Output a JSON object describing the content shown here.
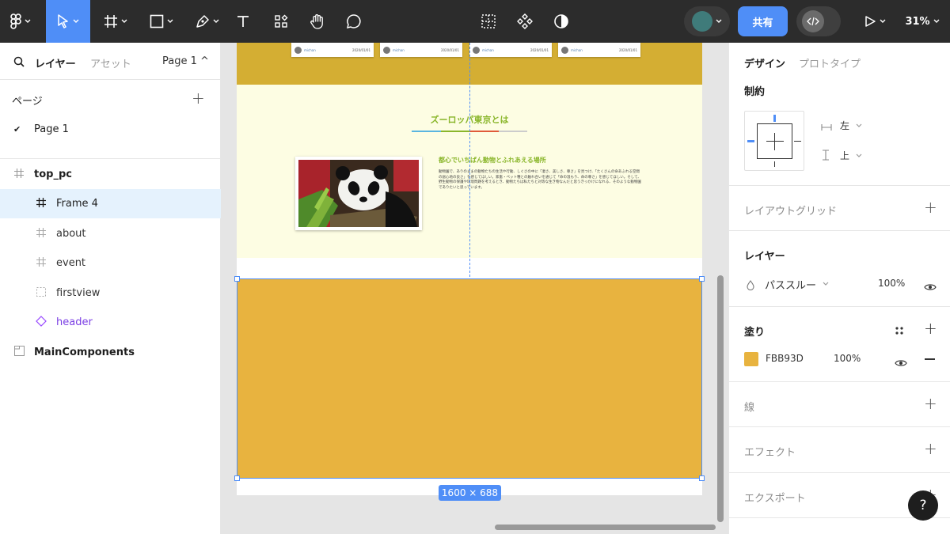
{
  "toolbar": {
    "share_label": "共有",
    "zoom_label": "31%",
    "colors": {
      "bg": "#2c2c2c",
      "active": "#4f8ef7",
      "share_bg": "#2d8cf0"
    }
  },
  "left": {
    "tabs": {
      "layers": "レイヤー",
      "assets": "アセット",
      "page_select": "Page 1 ^"
    },
    "pages_title": "ページ",
    "pages": [
      {
        "label": "Page 1",
        "checked": "✔"
      }
    ],
    "layers": [
      {
        "label": "top_pc"
      },
      {
        "label": "Frame 4"
      },
      {
        "label": "about"
      },
      {
        "label": "event"
      },
      {
        "label": "firstview"
      },
      {
        "label": "header"
      },
      {
        "label": "MainComponents"
      }
    ]
  },
  "canvas": {
    "cards": [
      {
        "name": "michan",
        "date": "2020/01/01"
      },
      {
        "name": "michan",
        "date": "2020/01/01"
      },
      {
        "name": "michan",
        "date": "2020/01/01"
      },
      {
        "name": "michan",
        "date": "2020/01/01"
      }
    ],
    "about_title": "ズーロッパ東京とは",
    "about_subtitle": "都心でいちばん動物とふれあえる場所",
    "about_body": "動物園で、ありのままの動物たちの生活や行動、しぐさの中に「凄さ、美しさ、尊さ」を見つけ、「たくさんの命あふれる空間の居心地の良さ」を感じてほしい。家畜・ペット種との触れ合いを通じて「命の温もり、命の尊さ」を感じてほしい。そして、野生動物の保護や環境問題を考えるとき、動物たちは私たちと対等な生き物なんだと思うきっかけになれる、そのような動物園でありたいと思っています。",
    "size_label": "1600 × 688",
    "frame_color": "#FBB93D"
  },
  "right": {
    "tabs": {
      "design": "デザイン",
      "prototype": "プロトタイプ"
    },
    "constraints_title": "制約",
    "constraint_h": "左",
    "constraint_v": "上",
    "layout_grid_title": "レイアウトグリッド",
    "layer_title": "レイヤー",
    "blend_mode": "パススルー",
    "layer_opacity": "100%",
    "fill_title": "塗り",
    "fill_hex": "FBB93D",
    "fill_opacity": "100%",
    "fill_color": "#E8B33F",
    "stroke_title": "線",
    "effects_title": "エフェクト",
    "export_title": "エクスポート",
    "help_label": "?"
  }
}
